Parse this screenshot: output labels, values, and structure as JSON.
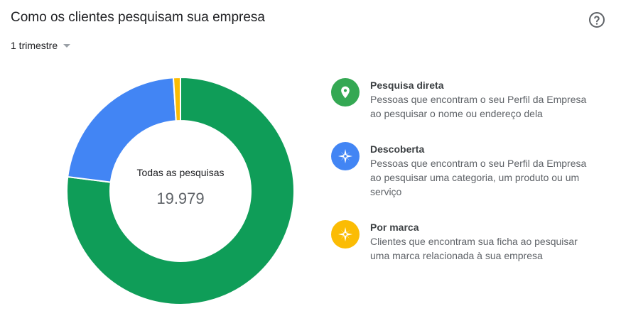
{
  "header": {
    "title": "Como os clientes pesquisam sua empresa",
    "period": "1 trimestre"
  },
  "icons": {
    "help": "help-circle-icon",
    "period_caret": "caret-down-icon",
    "direct": "map-pin-icon",
    "discovery": "compass-icon",
    "brand": "compass-icon"
  },
  "summary": {
    "label": "Todas as pesquisas",
    "total": "19.979"
  },
  "legend": [
    {
      "title": "Pesquisa direta",
      "description": "Pessoas que encontram o seu Perfil da Empresa ao pesquisar o nome ou endereço dela",
      "color": "#0f9d58"
    },
    {
      "title": "Descoberta",
      "description": "Pessoas que encontram o seu Perfil da Empresa ao pesquisar uma categoria, um produto ou um serviço",
      "color": "#4285f4"
    },
    {
      "title": "Por marca",
      "description": "Clientes que encontram sua ficha ao pesquisar uma marca relacionada à sua empresa",
      "color": "#fbbc04"
    }
  ],
  "chart_data": {
    "type": "pie",
    "categories": [
      "Pesquisa direta",
      "Descoberta",
      "Por marca"
    ],
    "values": [
      77,
      22,
      1
    ],
    "colors": [
      "#0f9d58",
      "#4285f4",
      "#fbbc04"
    ],
    "donut": true
  }
}
